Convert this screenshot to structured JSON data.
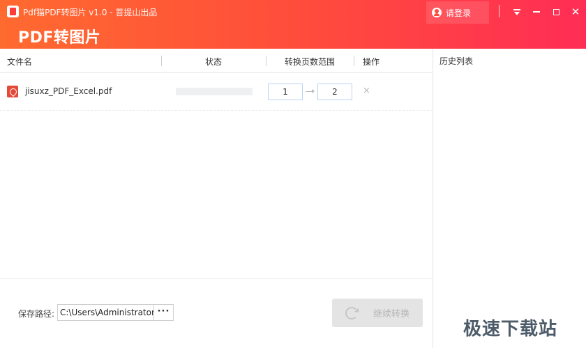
{
  "window": {
    "title": "Pdf猫PDF转图片 v1.0 - 菩提山出品",
    "app_title": "PDF转图片",
    "login_label": "请登录"
  },
  "table": {
    "headers": {
      "name": "文件名",
      "status": "状态",
      "range": "转换页数范围",
      "action": "操作"
    },
    "rows": [
      {
        "file_name": "jisuxz_PDF_Excel.pdf",
        "progress": 0,
        "page_from": "1",
        "page_to": "2",
        "remove_label": "×"
      }
    ]
  },
  "footer": {
    "path_label": "保存路径:",
    "path_value": "C:\\Users\\Administrator",
    "browse_label": "···",
    "convert_label": "继续转换"
  },
  "history": {
    "title": "历史列表"
  },
  "watermark": "极速下载站",
  "colors": {
    "header_start": "#ff6a2f",
    "header_end": "#ff2d55",
    "pdf_icon": "#e34a3a"
  },
  "icons": [
    "app-logo-icon",
    "user-icon",
    "menu-icon",
    "minimize-icon",
    "maximize-icon",
    "close-icon",
    "pdf-file-icon",
    "arrow-right-icon",
    "remove-icon",
    "refresh-icon"
  ]
}
